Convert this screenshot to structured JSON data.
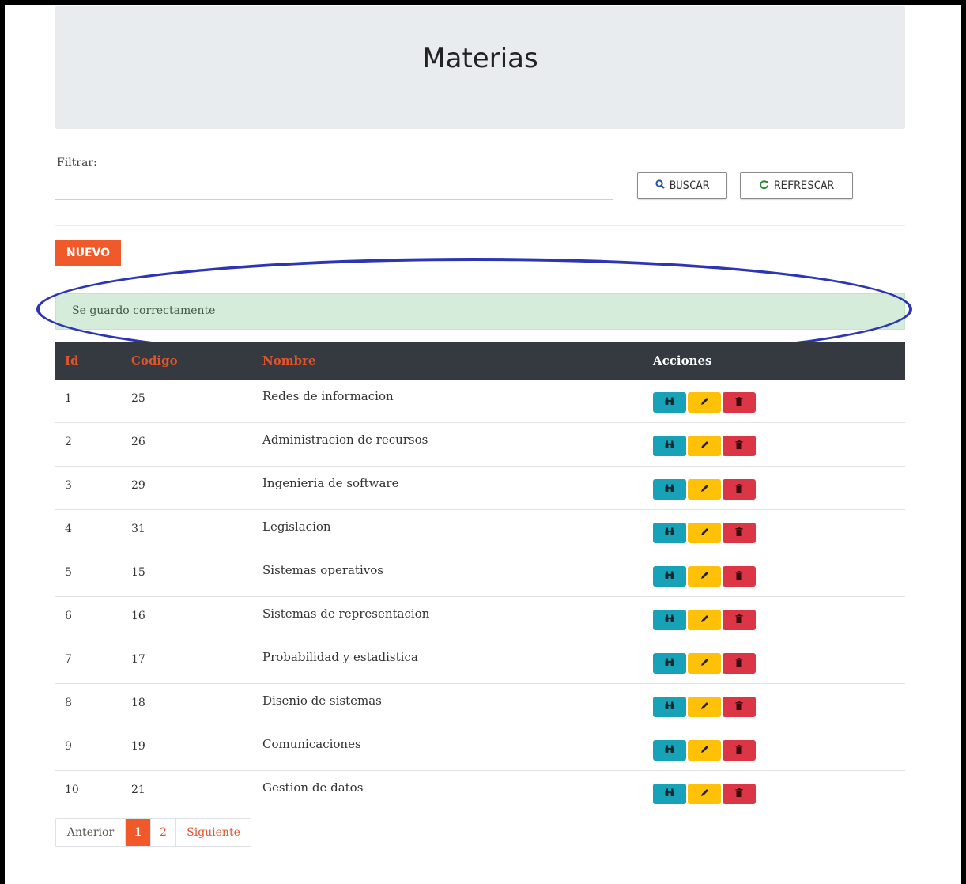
{
  "page": {
    "title": "Materias"
  },
  "filter": {
    "label": "Filtrar:",
    "value": ""
  },
  "toolbar": {
    "search_label": "BUSCAR",
    "refresh_label": "REFRESCAR",
    "new_label": "NUEVO"
  },
  "alert": {
    "message": "Se guardo correctamente",
    "annotation_color": "#2b35b5"
  },
  "table": {
    "headers": {
      "id": "Id",
      "codigo": "Codigo",
      "nombre": "Nombre",
      "acciones": "Acciones"
    },
    "rows": [
      {
        "id": "1",
        "codigo": "25",
        "nombre": "Redes de informacion"
      },
      {
        "id": "2",
        "codigo": "26",
        "nombre": "Administracion de recursos"
      },
      {
        "id": "3",
        "codigo": "29",
        "nombre": "Ingenieria de software"
      },
      {
        "id": "4",
        "codigo": "31",
        "nombre": "Legislacion"
      },
      {
        "id": "5",
        "codigo": "15",
        "nombre": "Sistemas operativos"
      },
      {
        "id": "6",
        "codigo": "16",
        "nombre": "Sistemas de representacion"
      },
      {
        "id": "7",
        "codigo": "17",
        "nombre": "Probabilidad y estadistica"
      },
      {
        "id": "8",
        "codigo": "18",
        "nombre": "Disenio de sistemas"
      },
      {
        "id": "9",
        "codigo": "19",
        "nombre": "Comunicaciones"
      },
      {
        "id": "10",
        "codigo": "21",
        "nombre": "Gestion de datos"
      }
    ],
    "row_actions": {
      "view_icon": "binoculars-icon",
      "edit_icon": "pencil-icon",
      "delete_icon": "trash-icon"
    }
  },
  "pagination": {
    "prev_label": "Anterior",
    "pages": [
      "1",
      "2"
    ],
    "current_page": "1",
    "next_label": "Siguiente"
  },
  "colors": {
    "accent": "#f05a2b",
    "header_bg": "#343a40",
    "success_bg": "#d4ecd9",
    "view_btn": "#17a2b8",
    "edit_btn": "#ffc107",
    "delete_btn": "#dc3545"
  }
}
